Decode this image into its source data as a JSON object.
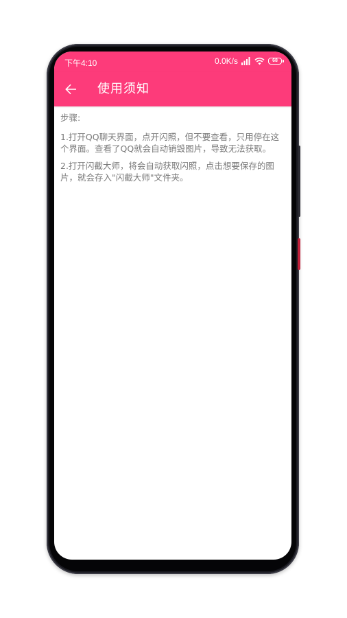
{
  "statusbar": {
    "time": "下午4:10",
    "speed": "0.0K/s",
    "battery": "68"
  },
  "appbar": {
    "title": "使用须知"
  },
  "content": {
    "heading": "步骤:",
    "step1": "1.打开QQ聊天界面，点开闪照，但不要查看，只用停在这个界面。查看了QQ就会自动销毁图片，导致无法获取。",
    "step2": "2.打开闪截大师，将会自动获取闪照，点击想要保存的图片，就会存入\"闪截大师\"文件夹。"
  },
  "colors": {
    "accent": "#fd3b7a",
    "text": "#7a7a7a",
    "frame": "#1a1a20"
  },
  "icons": {
    "back": "arrow-left-icon",
    "signal": "signal-icon",
    "wifi": "wifi-icon",
    "battery": "battery-icon"
  }
}
